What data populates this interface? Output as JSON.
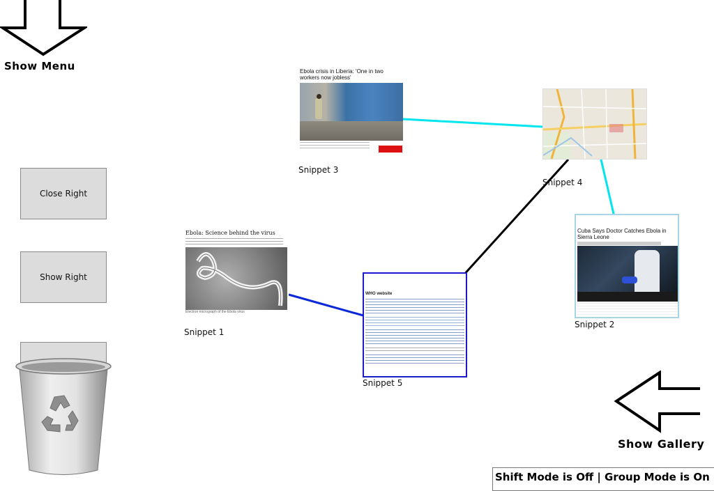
{
  "menu": {
    "show_menu_label": "Show Menu",
    "show_gallery_label": "Show Gallery"
  },
  "side_buttons": {
    "close_right": "Close Right",
    "show_right": "Show Right"
  },
  "snippets": {
    "s1": {
      "label": "Snippet 1",
      "title": "Ebola: Science behind the virus",
      "caption": "Electron micrograph of the Ebola virus"
    },
    "s2": {
      "label": "Snippet 2",
      "title": "Cuba Says Doctor Catches Ebola in Sierra Leone"
    },
    "s3": {
      "label": "Snippet 3",
      "title": "Ebola crisis in Liberia: 'One in two workers now jobless'"
    },
    "s4": {
      "label": "Snippet 4"
    },
    "s5": {
      "label": "Snippet 5",
      "heading": "WHO website"
    }
  },
  "status_bar": {
    "text": "Shift Mode is Off | Group Mode is On"
  },
  "colors": {
    "link_cyan": "#00e5ee",
    "link_blue": "#0a28d8",
    "link_black": "#000000",
    "selection_blue": "#1a1acc",
    "snippet2_border": "#a9d4e8"
  }
}
